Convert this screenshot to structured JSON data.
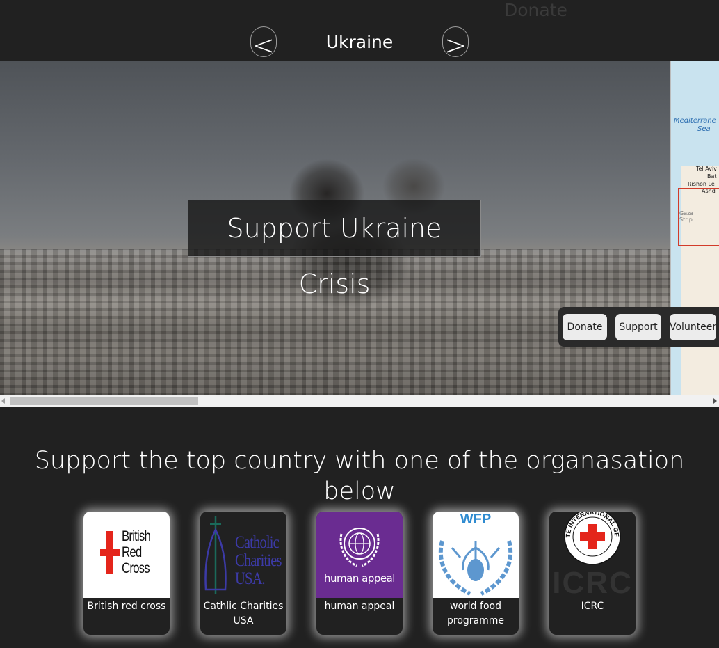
{
  "header": {
    "donate_link": "Donate",
    "country": "Ukraine",
    "prev_label": "<",
    "next_label": ">"
  },
  "hero": {
    "caption": "Support Ukraine Crisis",
    "map_labels": {
      "sea": "Mediterrane",
      "sea2": "Sea",
      "city1": "Tel Aviv",
      "city2": "Bat",
      "city3": "Rishon Le",
      "city4": "Ashd",
      "region": "Gaza Strip"
    },
    "actions": [
      "Donate",
      "Support",
      "Volunteer"
    ]
  },
  "section": {
    "heading": "Support the top country with one of the organasation below"
  },
  "organisations": [
    {
      "name": "British red cross",
      "logo_text": [
        "British",
        "Red",
        "Cross"
      ],
      "logo_icon": "red-cross-icon"
    },
    {
      "name": "Cathlic Charities USA",
      "logo_text": [
        "Catholic",
        "Charities",
        "USA."
      ],
      "logo_icon": "cathedral-cross-icon"
    },
    {
      "name": "human appeal",
      "logo_text": "human appeal",
      "logo_icon": "laurel-globe-icon"
    },
    {
      "name": "world food programme",
      "logo_text": "WFP",
      "logo_icon": "wheat-wreath-icon"
    },
    {
      "name": "ICRC",
      "logo_text": "ICRC",
      "logo_icon": "icrc-emblem-icon",
      "emblem_text": "COMITE INTERNATIONAL GENEVE"
    }
  ],
  "colors": {
    "background": "#212121",
    "red_cross": "#e4251b",
    "catholic_charities": "#3c3aa6",
    "human_appeal": "#6a2c91",
    "wfp_blue": "#2f8bd0"
  }
}
